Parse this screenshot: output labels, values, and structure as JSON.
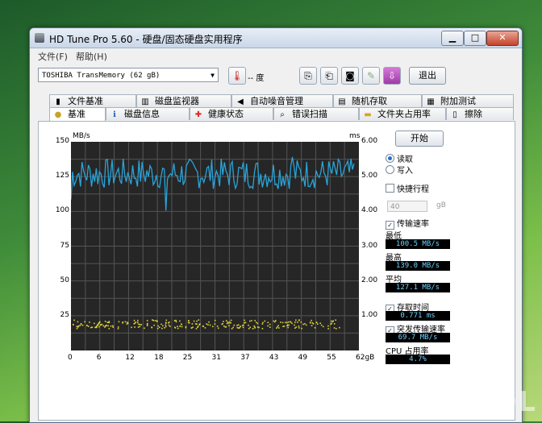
{
  "window": {
    "title": "HD Tune Pro 5.60 - 硬盘/固态硬盘实用程序"
  },
  "menu": [
    "文件(F)",
    "帮助(H)"
  ],
  "toolbar": {
    "drive": "TOSHIBA TransMemory (62 gB)",
    "temperature": "-- 度",
    "exit_label": "退出"
  },
  "tabs_top": [
    {
      "label": "文件基准",
      "icon": "file-icon"
    },
    {
      "label": "磁盘监视器",
      "icon": "monitor-icon"
    },
    {
      "label": "自动噪音管理",
      "icon": "speaker-icon"
    },
    {
      "label": "随机存取",
      "icon": "random-icon"
    },
    {
      "label": "附加测试",
      "icon": "extra-icon"
    }
  ],
  "tabs_bottom": [
    {
      "label": "基准",
      "icon": "benchmark-icon",
      "active": true
    },
    {
      "label": "磁盘信息",
      "icon": "info-icon"
    },
    {
      "label": "健康状态",
      "icon": "health-icon"
    },
    {
      "label": "错误扫描",
      "icon": "scan-icon"
    },
    {
      "label": "文件夹占用率",
      "icon": "folder-icon"
    },
    {
      "label": "擦除",
      "icon": "erase-icon"
    }
  ],
  "controls": {
    "start_label": "开始",
    "read_label": "读取",
    "write_label": "写入",
    "mode": "read",
    "quick_label": "快捷行程",
    "quick_value": "40",
    "quick_unit": "gB",
    "transfer_label": "传输速率",
    "min_label": "最低",
    "min_value": "100.5 MB/s",
    "max_label": "最高",
    "max_value": "139.0 MB/s",
    "avg_label": "平均",
    "avg_value": "127.1 MB/s",
    "access_label": "存取时间",
    "access_value": "0.771 ms",
    "burst_label": "突发传输速率",
    "burst_value": "69.7 MB/s",
    "cpu_label": "CPU 占用率",
    "cpu_value": "4.7%"
  },
  "chart_data": {
    "type": "line",
    "left_unit": "MB/s",
    "right_unit": "ms",
    "x_ticks": [
      "0",
      "6",
      "12",
      "18",
      "25",
      "31",
      "37",
      "43",
      "49",
      "55",
      "62gB"
    ],
    "y_left_ticks": [
      "150",
      "125",
      "100",
      "75",
      "50",
      "25"
    ],
    "y_right_ticks": [
      "6.00",
      "5.00",
      "4.00",
      "3.00",
      "2.00",
      "1.00"
    ],
    "ylim_left": [
      0,
      150
    ],
    "ylim_right": [
      0,
      6
    ],
    "xlim": [
      0,
      62
    ],
    "series": [
      {
        "name": "",
        "axis": "left",
        "color": "#2aa3d8",
        "summary": {
          "min": 100.5,
          "max": 139.0,
          "avg": 127.1
        }
      },
      {
        "name": "",
        "axis": "right",
        "color": "#e0d23a",
        "kind": "scatter",
        "typical_ms": 0.771
      }
    ]
  },
  "watermark": "ZOL"
}
